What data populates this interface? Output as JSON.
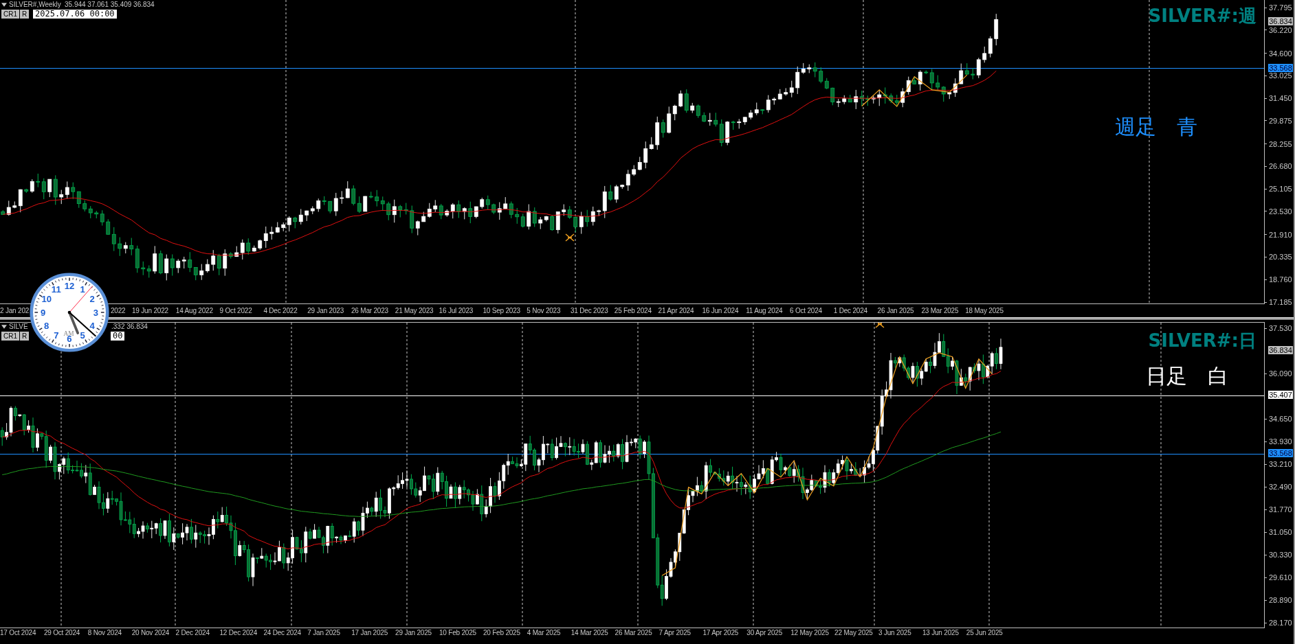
{
  "weekly_chart": {
    "header": {
      "symbol": "SILVER#,Weekly",
      "ohlc": "35.944 37.061 35.409 36.834"
    },
    "buttons": [
      "CR1",
      "R"
    ],
    "date_field": "2025.07.06 00:00",
    "title": "SILVER#:週",
    "note": {
      "text": "週足　青",
      "color": "#1e90ff"
    },
    "price_labels": [
      "37.795",
      "36.220",
      "34.600",
      "33.025",
      "31.450",
      "29.875",
      "28.255",
      "26.680",
      "25.105",
      "23.530",
      "21.910",
      "20.335",
      "18.760",
      "17.185"
    ],
    "price_badges": [
      {
        "text": "36.834",
        "kind": "bid"
      },
      {
        "text": "33.568",
        "kind": "line",
        "color": "#1e90ff"
      }
    ],
    "date_labels": [
      "2 Jan 202",
      "2022",
      "19 Jun 2022",
      "14 Aug 2022",
      "9 Oct 2022",
      "4 Dec 2022",
      "29 Jan 2023",
      "26 Mar 2023",
      "21 May 2023",
      "16 Jul 2023",
      "10 Sep 2023",
      "5 Nov 2023",
      "31 Dec 2023",
      "25 Feb 2024",
      "21 Apr 2024",
      "16 Jun 2024",
      "11 Aug 2024",
      "6 Oct 2024",
      "1 Dec 2024",
      "26 Jan 2025",
      "23 Mar 2025",
      "18 May 2025"
    ]
  },
  "daily_chart": {
    "header": {
      "symbol": "SILVE",
      "ohlc": ".332 36.834"
    },
    "buttons": [
      "CR1",
      "R"
    ],
    "date_field": "00",
    "title": "SILVER#:日",
    "note": {
      "text": "日足　白",
      "color": "#ffffff"
    },
    "price_labels": [
      "37.530",
      "36.090",
      "34.650",
      "33.930",
      "33.210",
      "32.490",
      "31.770",
      "31.050",
      "30.330",
      "29.610",
      "28.890",
      "28.170"
    ],
    "price_badges": [
      {
        "text": "36.834",
        "kind": "bid"
      },
      {
        "text": "35.407",
        "kind": "line",
        "color": "#ffffff"
      },
      {
        "text": "33.568",
        "kind": "line",
        "color": "#1e90ff"
      }
    ],
    "date_labels": [
      "17 Oct 2024",
      "29 Oct 2024",
      "8 Nov 2024",
      "20 Nov 2024",
      "2 Dec 2024",
      "12 Dec 2024",
      "24 Dec 2024",
      "7 Jan 2025",
      "17 Jan 2025",
      "29 Jan 2025",
      "10 Feb 2025",
      "20 Feb 2025",
      "4 Mar 2025",
      "14 Mar 2025",
      "26 Mar 2025",
      "7 Apr 2025",
      "17 Apr 2025",
      "30 Apr 2025",
      "12 May 2025",
      "22 May 2025",
      "3 Jun 2025",
      "13 Jun 2025",
      "25 Jun 2025"
    ]
  },
  "clock": {
    "numerals": [
      "12",
      "11",
      "1",
      "10",
      "2",
      "9",
      "3",
      "8",
      "4",
      "7",
      "5",
      "6"
    ],
    "meridiem": "AM"
  }
}
